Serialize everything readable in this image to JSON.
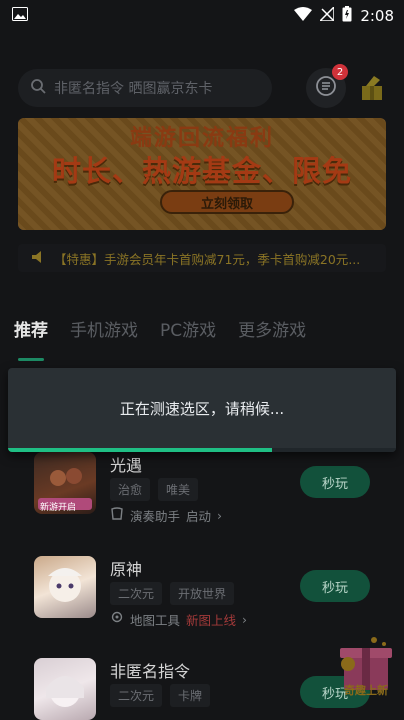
{
  "status_bar": {
    "time": "2:08"
  },
  "search": {
    "placeholder": "非匿名指令 晒图赢京东卡"
  },
  "header": {
    "message_badge": "2"
  },
  "banner": {
    "line1": "端游回流福利",
    "line2": "时长、热游基金、限免",
    "button": "立刻领取"
  },
  "notice": {
    "text": "【特惠】手游会员年卡首购减71元，季卡首购减20元..."
  },
  "tabs": [
    {
      "label": "推荐"
    },
    {
      "label": "手机游戏"
    },
    {
      "label": "PC游戏"
    },
    {
      "label": "更多游戏"
    }
  ],
  "toast": {
    "text": "正在测速选区，请稍候...",
    "progress": 0.68
  },
  "games": [
    {
      "name": "光遇",
      "tags": [
        "治愈",
        "唯美"
      ],
      "extra_label": "演奏助手",
      "extra_action": "启动",
      "thumb_caption": "新游开启",
      "play": "秒玩"
    },
    {
      "name": "原神",
      "tags": [
        "二次元",
        "开放世界"
      ],
      "extra_label": "地图工具",
      "extra_action": "新图上线",
      "thumb_caption": "",
      "play": "秒玩"
    },
    {
      "name": "非匿名指令",
      "tags": [
        "二次元",
        "卡牌"
      ],
      "extra_label": "",
      "extra_action": "",
      "thumb_caption": "",
      "play": "秒玩"
    }
  ],
  "floating_gift": {
    "label": "奇趣上新"
  },
  "colors": {
    "accent": "#1fbf84",
    "badge": "#d0323a",
    "background": "#141517"
  }
}
